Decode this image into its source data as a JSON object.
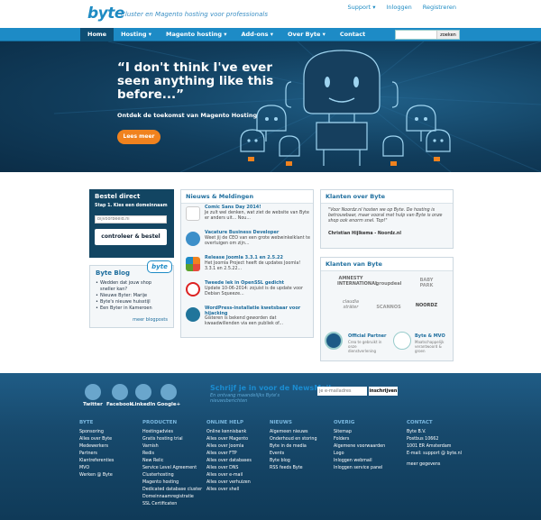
{
  "header": {
    "logo": "byte",
    "tagline": "Cluster en Magento hosting voor professionals",
    "links": [
      "Support ▾",
      "Inloggen",
      "Registreren"
    ]
  },
  "nav": {
    "items": [
      "Home",
      "Hosting ▾",
      "Magento hosting ▾",
      "Add-ons ▾",
      "Over Byte ▾",
      "Contact"
    ],
    "search_button": "zoeken"
  },
  "hero": {
    "quote": "“I don't think I've ever seen anything like this before...”",
    "subtitle": "Ontdek de toekomst van Magento Hosting",
    "button": "Lees meer"
  },
  "bestel": {
    "title": "Bestel direct",
    "step": "Stap 1. Kies een domeinnaam",
    "placeholder": "bijvoorbeeld.nl",
    "button": "controleer & bestel"
  },
  "blog": {
    "title": "Byte Blog",
    "tag": "byte",
    "items": [
      "Wedden dat jouw shop sneller kan?",
      "Nieuwe Byter: Marije",
      "Byte's nieuwe huisstijl",
      "Een Byter in Kameroen"
    ],
    "more": "meer blogposts"
  },
  "news": {
    "title": "Nieuws & Meldingen",
    "items": [
      {
        "title": "Comic Sans Day 2014!",
        "text": "Je zult wel denken, wat ziet de website van Byte er anders uit... Nou..."
      },
      {
        "title": "Vacature Business Developer",
        "text": "Weet jij de CEO van een grote webwinkelklant te overtuigen om zijn..."
      },
      {
        "title": "Release Joomla 3.3.1 en 2.5.22",
        "text": "Het Joomla Project heeft de updates Joomla! 3.3.1 en 2.5.22..."
      },
      {
        "title": "Tweede lek in OpenSSL gedicht",
        "text": "Update 10-06-2014: zojuist is de update voor Debian Squeeze..."
      },
      {
        "title": "WordPress-installatie kwetsbaar voor hijacking",
        "text": "Gisteren is bekend geworden dat kwaadwillenden via een publiek of..."
      }
    ]
  },
  "klant": {
    "title": "Klanten over Byte",
    "quote": "\"Voor Noordz.nl hosten we op Byte. De hosting is betrouwbaar, maar vooral met hulp van Byte is onze shop ook enorm snel. Top!\"",
    "author": "Christian Hijlkema - Noordz.nl"
  },
  "klanten": {
    "title": "Klanten van Byte",
    "logos": [
      "AMNESTY INTERNATIONAL",
      "groupdeal",
      "BABY PARK",
      "claudia sträter",
      "SCANNOS",
      "NOORDZ"
    ],
    "partners": [
      {
        "label": "Official Partner",
        "sub": "Crea te gebruikt in onze dienstverlening"
      },
      {
        "label": "Byte & MVO",
        "sub": "Maatschappelijk verantwoord & groen"
      }
    ]
  },
  "footer": {
    "social": [
      "Twitter",
      "Facebook",
      "LinkedIn",
      "Google+"
    ],
    "newsletter": {
      "title": "Schrijf je in voor de NewsMail",
      "text": "En ontvang maandelijks Byte's nieuwsberichten",
      "placeholder": "je e-mailadres",
      "button": "inschrijven"
    },
    "columns": [
      {
        "title": "BYTE",
        "items": [
          "Sponsoring",
          "Alles over Byte",
          "Medewerkers",
          "Partners",
          "Klantreferenties",
          "MVO",
          "Werken @ Byte"
        ]
      },
      {
        "title": "PRODUCTEN",
        "items": [
          "Hostingadvies",
          "Gratis hosting trial",
          "Varnish",
          "Redis",
          "New Relic",
          "Service Level Agreement",
          "Clusterhosting",
          "Magento hosting",
          "Dedicated database cluster",
          "Domeinnaamregistratie",
          "SSL Certificaten"
        ]
      },
      {
        "title": "ONLINE HELP",
        "items": [
          "Online kennisbank",
          "Alles over Magento",
          "Alles over Joomla",
          "Alles over FTP",
          "Alles over databases",
          "Alles over DNS",
          "Alles over e-mail",
          "Alles over verhuizen",
          "Alles over shell"
        ]
      },
      {
        "title": "NIEUWS",
        "items": [
          "Algemeen nieuws",
          "Onderhoud en storing",
          "Byte in de media",
          "Events",
          "Byte blog",
          "RSS feeds Byte"
        ]
      },
      {
        "title": "OVERIG",
        "items": [
          "Sitemap",
          "Folders",
          "Algemene voorwaarden",
          "Logo",
          "Inloggen webmail",
          "Inloggen service panel"
        ]
      },
      {
        "title": "CONTACT",
        "items": [
          "Byte B.V.",
          "Postbus 10662",
          "1001 ER Amsterdam",
          "E-mail: support @ byte.nl",
          "",
          "meer gegevens"
        ]
      }
    ]
  }
}
